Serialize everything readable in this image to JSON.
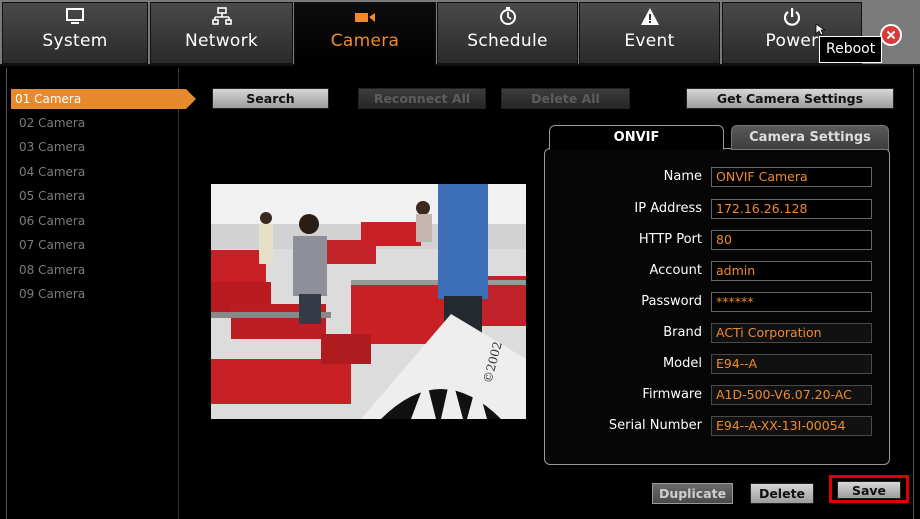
{
  "nav": {
    "tabs": [
      {
        "label": "System",
        "icon": "monitor-icon"
      },
      {
        "label": "Network",
        "icon": "network-icon"
      },
      {
        "label": "Camera",
        "icon": "camera-icon"
      },
      {
        "label": "Schedule",
        "icon": "clock-icon"
      },
      {
        "label": "Event",
        "icon": "alert-icon"
      },
      {
        "label": "Power",
        "icon": "power-icon"
      }
    ],
    "active": "Camera",
    "tooltip": "Reboot"
  },
  "sidebar": {
    "items": [
      "01 Camera",
      "02 Camera",
      "03 Camera",
      "04 Camera",
      "05 Camera",
      "06 Camera",
      "07 Camera",
      "08 Camera",
      "09 Camera"
    ],
    "selected": "01 Camera"
  },
  "toolbar": {
    "search": "Search",
    "reconnect_all": "Reconnect All",
    "delete_all": "Delete All",
    "get_settings": "Get Camera Settings"
  },
  "panel": {
    "tabs": [
      "ONVIF",
      "Camera Settings"
    ],
    "fields": [
      {
        "label": "Name",
        "value": "ONVIF Camera"
      },
      {
        "label": "IP Address",
        "value": "172.16.26.128"
      },
      {
        "label": "HTTP Port",
        "value": "80"
      },
      {
        "label": "Account",
        "value": "admin"
      },
      {
        "label": "Password",
        "value": "******"
      },
      {
        "label": "Brand",
        "value": "ACTi Corporation"
      },
      {
        "label": "Model",
        "value": "E94--A"
      },
      {
        "label": "Firmware",
        "value": "A1D-500-V6.07.20-AC"
      },
      {
        "label": "Serial Number",
        "value": "E94--A-XX-13I-00054"
      }
    ]
  },
  "actions": {
    "duplicate": "Duplicate",
    "delete": "Delete",
    "save": "Save"
  },
  "colors": {
    "accent": "#e7892d",
    "field_text": "#ef8a2d",
    "highlight": "#e00000"
  }
}
